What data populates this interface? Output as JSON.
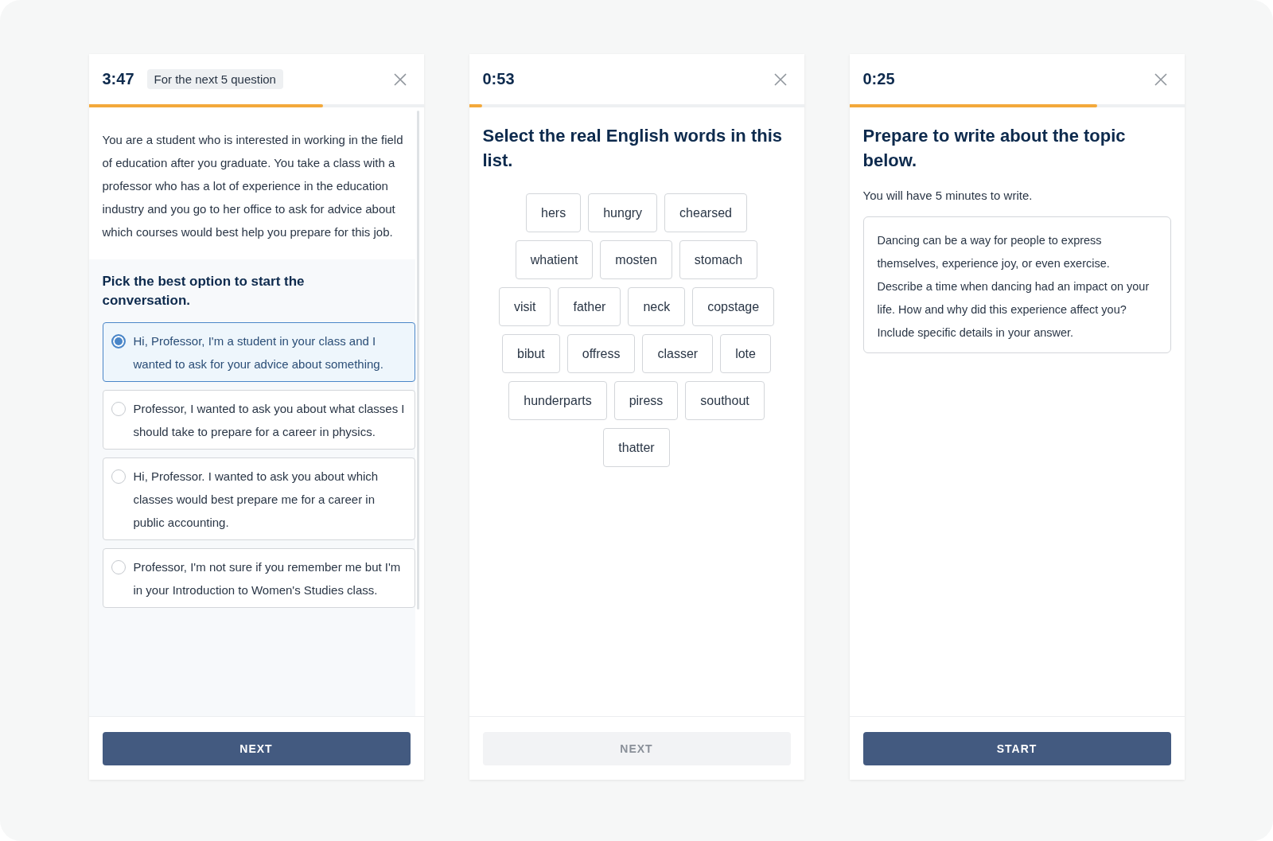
{
  "panels": [
    {
      "kind": "reading",
      "timer": "3:47",
      "badge": "For the next 5 question",
      "progress": {
        "level": 0.7
      },
      "passage": "You are a student who is interested in working in the field of education after you graduate. You take a class with a professor who has a lot of experience in the education industry and you go to her office to ask for advice about which courses would best help you prepare for this job.",
      "question": "Pick the best option to start the conversation.",
      "options": [
        {
          "text": "Hi, Professor, I'm a student in your class and I wanted to ask for your advice about something.",
          "selected": true
        },
        {
          "text": "Professor, I wanted to ask you about what classes I should take to prepare for a career in physics.",
          "selected": false
        },
        {
          "text": "Hi, Professor. I wanted to ask you about which classes would best prepare me for a career in public accounting.",
          "selected": false
        },
        {
          "text": "Professor, I'm not sure if you remember me but I'm in your Introduction to Women's Studies class.",
          "selected": false
        }
      ],
      "button": {
        "label": "NEXT",
        "disabled": false
      }
    },
    {
      "kind": "words",
      "timer": "0:53",
      "progress": {
        "level": 0.04
      },
      "title": "Select the real English words in this list.",
      "word_rows": [
        [
          "hers",
          "hungry",
          "chearsed"
        ],
        [
          "whatient",
          "mosten",
          "stomach"
        ],
        [
          "visit",
          "father",
          "neck",
          "copstage"
        ],
        [
          "bibut",
          "offress",
          "classer",
          "lote"
        ],
        [
          "hunderparts",
          "piress",
          "southout"
        ],
        [
          "thatter"
        ]
      ],
      "button": {
        "label": "NEXT",
        "disabled": true
      }
    },
    {
      "kind": "writing",
      "timer": "0:25",
      "progress": {
        "level": 0.74
      },
      "title": "Prepare to write about the topic below.",
      "subtitle": "You will have 5 minutes to write.",
      "prompt": "Dancing can be a way for people to express themselves, experience joy, or even exercise. Describe a time when dancing had an impact on your life. How and why did this experience affect you? Include specific details in your answer.",
      "button": {
        "label": "START",
        "disabled": false
      }
    }
  ]
}
